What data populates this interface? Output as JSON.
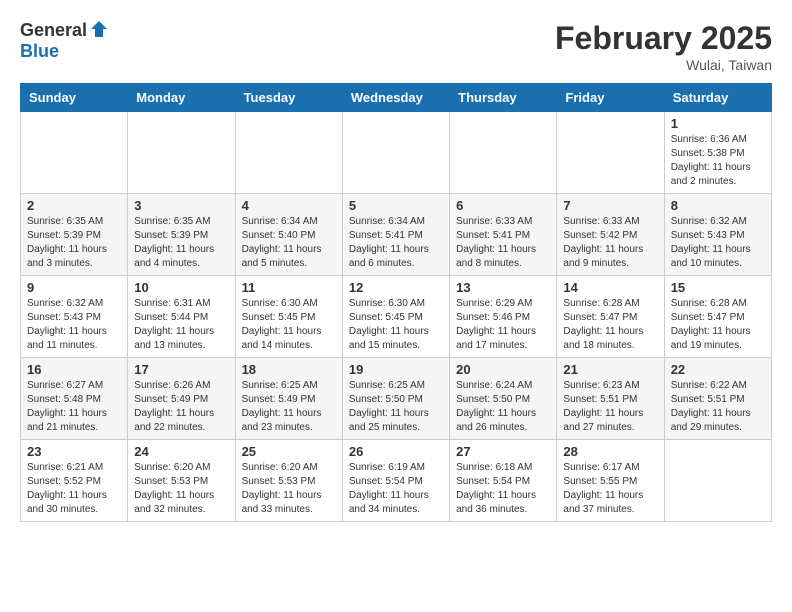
{
  "logo": {
    "general": "General",
    "blue": "Blue"
  },
  "title": "February 2025",
  "location": "Wulai, Taiwan",
  "days_of_week": [
    "Sunday",
    "Monday",
    "Tuesday",
    "Wednesday",
    "Thursday",
    "Friday",
    "Saturday"
  ],
  "weeks": [
    [
      {
        "day": "",
        "info": ""
      },
      {
        "day": "",
        "info": ""
      },
      {
        "day": "",
        "info": ""
      },
      {
        "day": "",
        "info": ""
      },
      {
        "day": "",
        "info": ""
      },
      {
        "day": "",
        "info": ""
      },
      {
        "day": "1",
        "info": "Sunrise: 6:36 AM\nSunset: 5:38 PM\nDaylight: 11 hours and 2 minutes."
      }
    ],
    [
      {
        "day": "2",
        "info": "Sunrise: 6:35 AM\nSunset: 5:39 PM\nDaylight: 11 hours and 3 minutes."
      },
      {
        "day": "3",
        "info": "Sunrise: 6:35 AM\nSunset: 5:39 PM\nDaylight: 11 hours and 4 minutes."
      },
      {
        "day": "4",
        "info": "Sunrise: 6:34 AM\nSunset: 5:40 PM\nDaylight: 11 hours and 5 minutes."
      },
      {
        "day": "5",
        "info": "Sunrise: 6:34 AM\nSunset: 5:41 PM\nDaylight: 11 hours and 6 minutes."
      },
      {
        "day": "6",
        "info": "Sunrise: 6:33 AM\nSunset: 5:41 PM\nDaylight: 11 hours and 8 minutes."
      },
      {
        "day": "7",
        "info": "Sunrise: 6:33 AM\nSunset: 5:42 PM\nDaylight: 11 hours and 9 minutes."
      },
      {
        "day": "8",
        "info": "Sunrise: 6:32 AM\nSunset: 5:43 PM\nDaylight: 11 hours and 10 minutes."
      }
    ],
    [
      {
        "day": "9",
        "info": "Sunrise: 6:32 AM\nSunset: 5:43 PM\nDaylight: 11 hours and 11 minutes."
      },
      {
        "day": "10",
        "info": "Sunrise: 6:31 AM\nSunset: 5:44 PM\nDaylight: 11 hours and 13 minutes."
      },
      {
        "day": "11",
        "info": "Sunrise: 6:30 AM\nSunset: 5:45 PM\nDaylight: 11 hours and 14 minutes."
      },
      {
        "day": "12",
        "info": "Sunrise: 6:30 AM\nSunset: 5:45 PM\nDaylight: 11 hours and 15 minutes."
      },
      {
        "day": "13",
        "info": "Sunrise: 6:29 AM\nSunset: 5:46 PM\nDaylight: 11 hours and 17 minutes."
      },
      {
        "day": "14",
        "info": "Sunrise: 6:28 AM\nSunset: 5:47 PM\nDaylight: 11 hours and 18 minutes."
      },
      {
        "day": "15",
        "info": "Sunrise: 6:28 AM\nSunset: 5:47 PM\nDaylight: 11 hours and 19 minutes."
      }
    ],
    [
      {
        "day": "16",
        "info": "Sunrise: 6:27 AM\nSunset: 5:48 PM\nDaylight: 11 hours and 21 minutes."
      },
      {
        "day": "17",
        "info": "Sunrise: 6:26 AM\nSunset: 5:49 PM\nDaylight: 11 hours and 22 minutes."
      },
      {
        "day": "18",
        "info": "Sunrise: 6:25 AM\nSunset: 5:49 PM\nDaylight: 11 hours and 23 minutes."
      },
      {
        "day": "19",
        "info": "Sunrise: 6:25 AM\nSunset: 5:50 PM\nDaylight: 11 hours and 25 minutes."
      },
      {
        "day": "20",
        "info": "Sunrise: 6:24 AM\nSunset: 5:50 PM\nDaylight: 11 hours and 26 minutes."
      },
      {
        "day": "21",
        "info": "Sunrise: 6:23 AM\nSunset: 5:51 PM\nDaylight: 11 hours and 27 minutes."
      },
      {
        "day": "22",
        "info": "Sunrise: 6:22 AM\nSunset: 5:51 PM\nDaylight: 11 hours and 29 minutes."
      }
    ],
    [
      {
        "day": "23",
        "info": "Sunrise: 6:21 AM\nSunset: 5:52 PM\nDaylight: 11 hours and 30 minutes."
      },
      {
        "day": "24",
        "info": "Sunrise: 6:20 AM\nSunset: 5:53 PM\nDaylight: 11 hours and 32 minutes."
      },
      {
        "day": "25",
        "info": "Sunrise: 6:20 AM\nSunset: 5:53 PM\nDaylight: 11 hours and 33 minutes."
      },
      {
        "day": "26",
        "info": "Sunrise: 6:19 AM\nSunset: 5:54 PM\nDaylight: 11 hours and 34 minutes."
      },
      {
        "day": "27",
        "info": "Sunrise: 6:18 AM\nSunset: 5:54 PM\nDaylight: 11 hours and 36 minutes."
      },
      {
        "day": "28",
        "info": "Sunrise: 6:17 AM\nSunset: 5:55 PM\nDaylight: 11 hours and 37 minutes."
      },
      {
        "day": "",
        "info": ""
      }
    ]
  ]
}
